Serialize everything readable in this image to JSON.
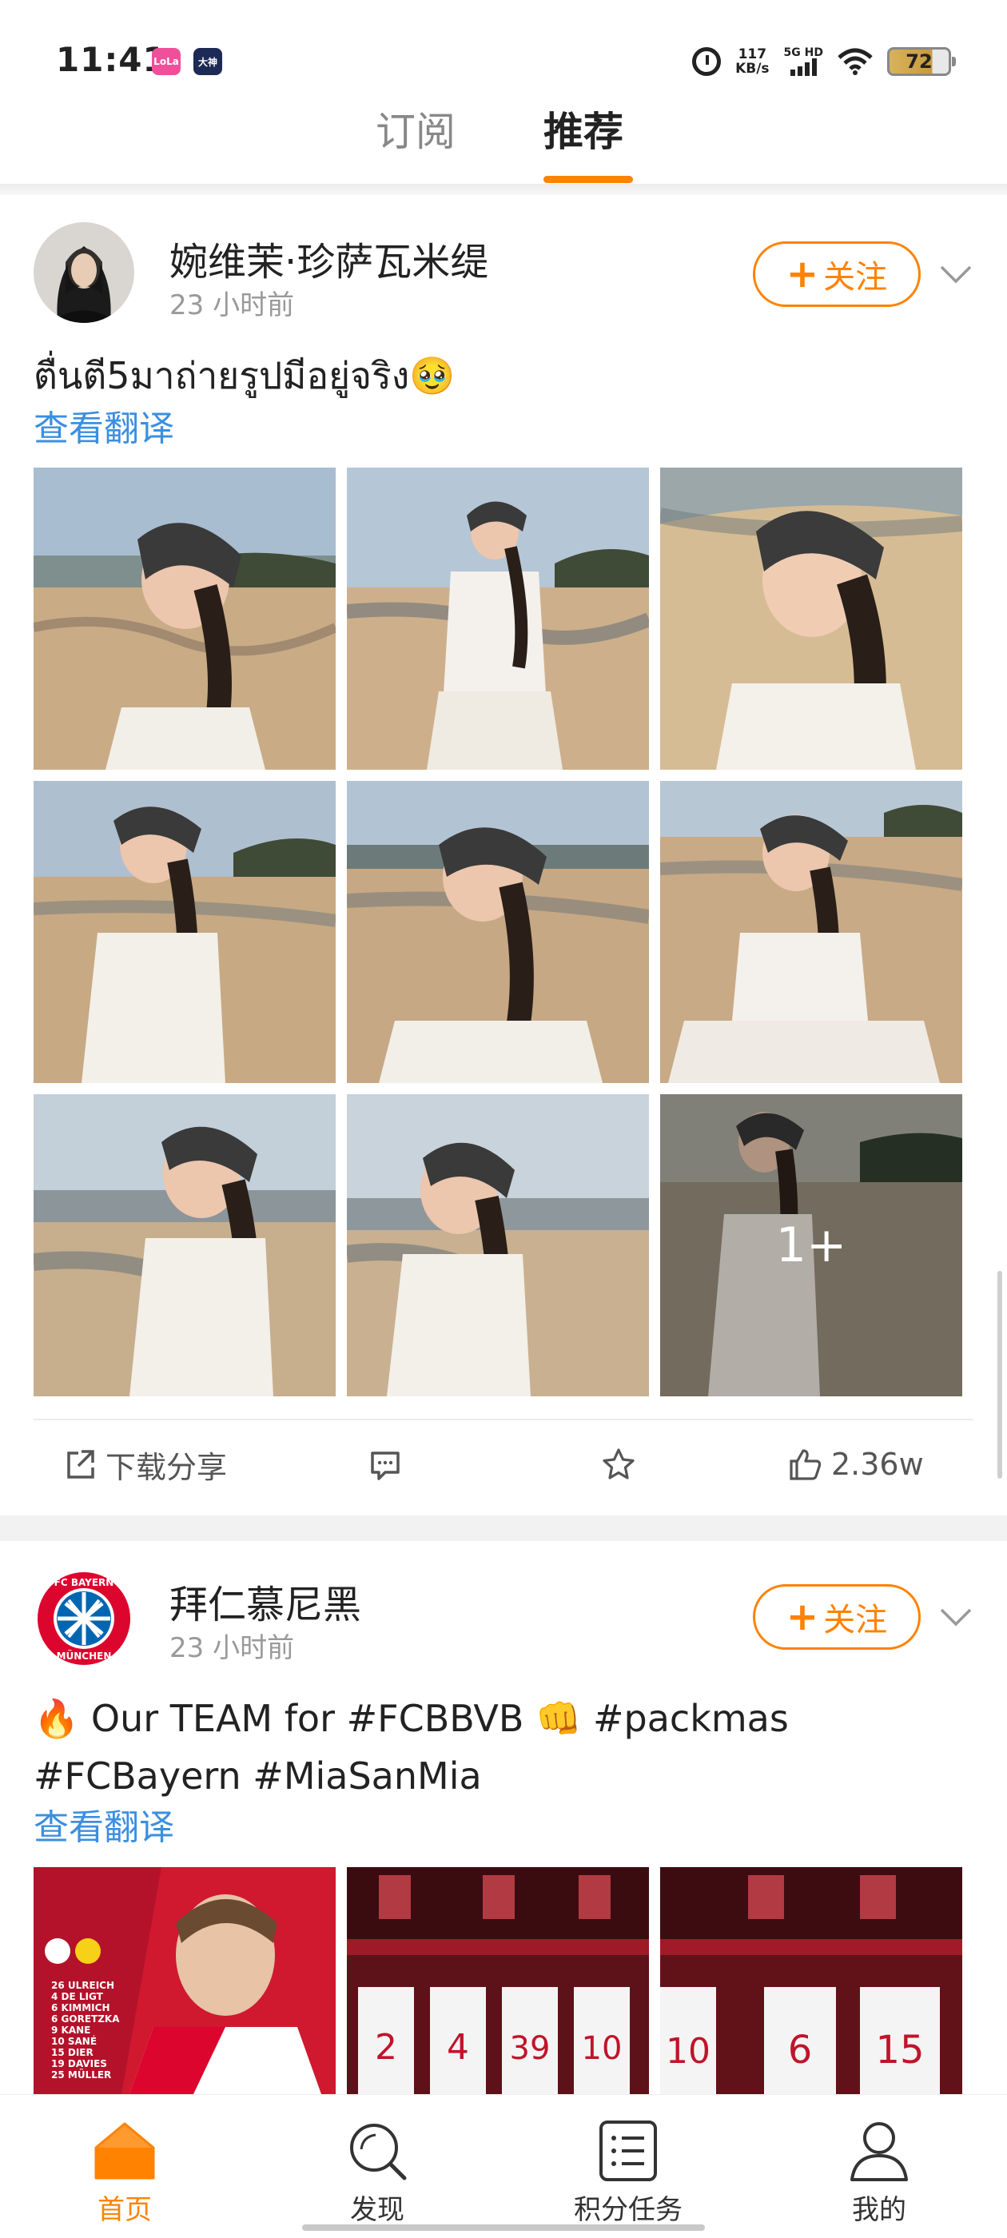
{
  "status_bar": {
    "time": "11:41",
    "badge_1": "LoLa",
    "badge_2": "大神",
    "net_speed_value": "117",
    "net_speed_unit": "KB/s",
    "signal_label": "5G HD",
    "battery": "72"
  },
  "top_tabs": {
    "subscribe": "订阅",
    "recommend": "推荐",
    "active": "推荐"
  },
  "colors": {
    "accent": "#ff8200",
    "link": "#3b8fe0"
  },
  "posts": [
    {
      "username": "婉维茉·珍萨瓦米缇",
      "time": "23 小时前",
      "follow_label": "关注",
      "text": "ตื่นตี5มาถ่ายรูปมีอยู่จริง🥹",
      "translate_label": "查看翻译",
      "more_count": "1+",
      "actions": {
        "share_label": "下载分享",
        "comment_icon": "comment-icon",
        "favorite_icon": "star-icon",
        "like_count": "2.36w"
      }
    },
    {
      "username": "拜仁慕尼黑",
      "time": "23 小时前",
      "follow_label": "关注",
      "text_line1": "🔥 Our TEAM for #FCBBVB 👊 #packmas",
      "text_line2": "#FCBayern #MiaSanMia",
      "translate_label": "查看翻译",
      "logo_text_top": "FC BAYERN",
      "logo_text_bottom": "MÜNCHEN",
      "lineup": [
        "26 ULREICH",
        "4 DE LIGT",
        "6 KIMMICH",
        "6 GORETZKA",
        "9 KANE",
        "10 SANÉ",
        "15 DIER",
        "19 DAVIES",
        "25 MÜLLER"
      ],
      "jersey_numbers_1": [
        "2",
        "4",
        "39",
        "10"
      ],
      "jersey_numbers_2": [
        "10",
        "6",
        "15"
      ]
    }
  ],
  "bottom_nav": [
    {
      "label": "首页",
      "icon": "home-icon",
      "active": true
    },
    {
      "label": "发现",
      "icon": "search-icon",
      "active": false
    },
    {
      "label": "积分任务",
      "icon": "task-list-icon",
      "active": false
    },
    {
      "label": "我的",
      "icon": "profile-icon",
      "active": false
    }
  ]
}
